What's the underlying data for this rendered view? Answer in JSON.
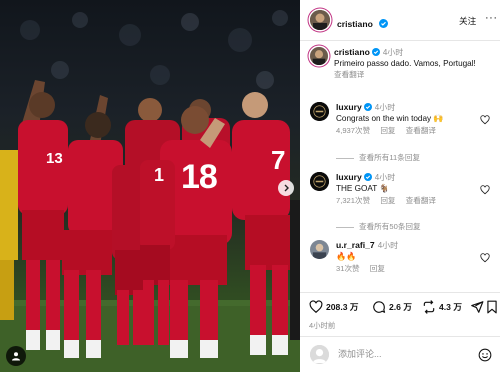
{
  "post": {
    "author": "cristiano",
    "follow_label": "关注",
    "more_label": "···",
    "caption_author": "cristiano",
    "caption_time": "4小时",
    "caption_text": "Primeiro passo dado. Vamos, Portugal!",
    "translate_label": "查看翻译"
  },
  "photo": {
    "jersey_numbers": [
      "13",
      "18",
      "7",
      "1"
    ]
  },
  "comments": [
    {
      "user": "luxury",
      "verified": true,
      "time": "4小时",
      "text": "Congrats on the win today 🙌",
      "likes": "4,937次赞",
      "reply_label": "回复",
      "translate_label": "查看翻译",
      "view_replies": "查看所有11条回复"
    },
    {
      "user": "luxury",
      "verified": true,
      "time": "4小时",
      "text": "THE GOAT 🐐",
      "likes": "7,321次赞",
      "reply_label": "回复",
      "translate_label": "查看翻译",
      "view_replies": "查看所有50条回复"
    },
    {
      "user": "u.r_rafi_7",
      "verified": false,
      "time": "4小时",
      "text": "🔥🔥",
      "likes": "31次赞",
      "reply_label": "回复"
    }
  ],
  "actions": {
    "likes": "208.3 万",
    "comments": "2.6 万",
    "reposts": "4.3 万"
  },
  "posted_time": "4小时前",
  "composer": {
    "placeholder": "添加评论..."
  },
  "icons": {
    "verified": "verified-badge-icon",
    "heart": "heart-icon",
    "comment": "comment-icon",
    "repost": "repost-icon",
    "share": "share-icon",
    "save": "bookmark-icon",
    "emoji": "emoji-icon",
    "next": "chevron-right-icon",
    "user_tag": "user-tag-icon"
  },
  "colors": {
    "verified": "#0095f6",
    "jersey": "#c8102e",
    "shorts": "#b50d24",
    "pitch": "#3a5b26",
    "muted_text": "#8e8e8e"
  }
}
